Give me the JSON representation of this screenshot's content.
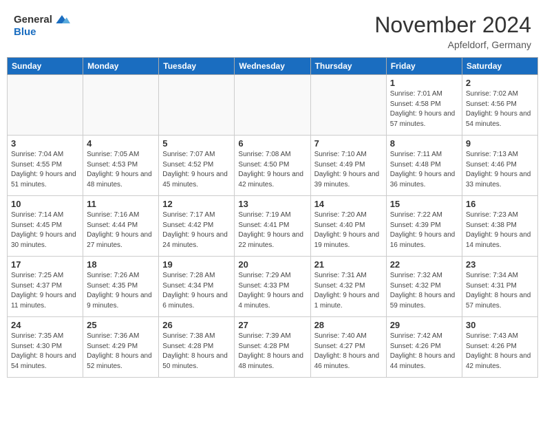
{
  "header": {
    "logo_general": "General",
    "logo_blue": "Blue",
    "title": "November 2024",
    "subtitle": "Apfeldorf, Germany"
  },
  "columns": [
    "Sunday",
    "Monday",
    "Tuesday",
    "Wednesday",
    "Thursday",
    "Friday",
    "Saturday"
  ],
  "weeks": [
    [
      {
        "day": "",
        "info": "",
        "empty": true
      },
      {
        "day": "",
        "info": "",
        "empty": true
      },
      {
        "day": "",
        "info": "",
        "empty": true
      },
      {
        "day": "",
        "info": "",
        "empty": true
      },
      {
        "day": "",
        "info": "",
        "empty": true
      },
      {
        "day": "1",
        "info": "Sunrise: 7:01 AM\nSunset: 4:58 PM\nDaylight: 9 hours and 57 minutes.",
        "empty": false
      },
      {
        "day": "2",
        "info": "Sunrise: 7:02 AM\nSunset: 4:56 PM\nDaylight: 9 hours and 54 minutes.",
        "empty": false
      }
    ],
    [
      {
        "day": "3",
        "info": "Sunrise: 7:04 AM\nSunset: 4:55 PM\nDaylight: 9 hours and 51 minutes.",
        "empty": false
      },
      {
        "day": "4",
        "info": "Sunrise: 7:05 AM\nSunset: 4:53 PM\nDaylight: 9 hours and 48 minutes.",
        "empty": false
      },
      {
        "day": "5",
        "info": "Sunrise: 7:07 AM\nSunset: 4:52 PM\nDaylight: 9 hours and 45 minutes.",
        "empty": false
      },
      {
        "day": "6",
        "info": "Sunrise: 7:08 AM\nSunset: 4:50 PM\nDaylight: 9 hours and 42 minutes.",
        "empty": false
      },
      {
        "day": "7",
        "info": "Sunrise: 7:10 AM\nSunset: 4:49 PM\nDaylight: 9 hours and 39 minutes.",
        "empty": false
      },
      {
        "day": "8",
        "info": "Sunrise: 7:11 AM\nSunset: 4:48 PM\nDaylight: 9 hours and 36 minutes.",
        "empty": false
      },
      {
        "day": "9",
        "info": "Sunrise: 7:13 AM\nSunset: 4:46 PM\nDaylight: 9 hours and 33 minutes.",
        "empty": false
      }
    ],
    [
      {
        "day": "10",
        "info": "Sunrise: 7:14 AM\nSunset: 4:45 PM\nDaylight: 9 hours and 30 minutes.",
        "empty": false
      },
      {
        "day": "11",
        "info": "Sunrise: 7:16 AM\nSunset: 4:44 PM\nDaylight: 9 hours and 27 minutes.",
        "empty": false
      },
      {
        "day": "12",
        "info": "Sunrise: 7:17 AM\nSunset: 4:42 PM\nDaylight: 9 hours and 24 minutes.",
        "empty": false
      },
      {
        "day": "13",
        "info": "Sunrise: 7:19 AM\nSunset: 4:41 PM\nDaylight: 9 hours and 22 minutes.",
        "empty": false
      },
      {
        "day": "14",
        "info": "Sunrise: 7:20 AM\nSunset: 4:40 PM\nDaylight: 9 hours and 19 minutes.",
        "empty": false
      },
      {
        "day": "15",
        "info": "Sunrise: 7:22 AM\nSunset: 4:39 PM\nDaylight: 9 hours and 16 minutes.",
        "empty": false
      },
      {
        "day": "16",
        "info": "Sunrise: 7:23 AM\nSunset: 4:38 PM\nDaylight: 9 hours and 14 minutes.",
        "empty": false
      }
    ],
    [
      {
        "day": "17",
        "info": "Sunrise: 7:25 AM\nSunset: 4:37 PM\nDaylight: 9 hours and 11 minutes.",
        "empty": false
      },
      {
        "day": "18",
        "info": "Sunrise: 7:26 AM\nSunset: 4:35 PM\nDaylight: 9 hours and 9 minutes.",
        "empty": false
      },
      {
        "day": "19",
        "info": "Sunrise: 7:28 AM\nSunset: 4:34 PM\nDaylight: 9 hours and 6 minutes.",
        "empty": false
      },
      {
        "day": "20",
        "info": "Sunrise: 7:29 AM\nSunset: 4:33 PM\nDaylight: 9 hours and 4 minutes.",
        "empty": false
      },
      {
        "day": "21",
        "info": "Sunrise: 7:31 AM\nSunset: 4:32 PM\nDaylight: 9 hours and 1 minute.",
        "empty": false
      },
      {
        "day": "22",
        "info": "Sunrise: 7:32 AM\nSunset: 4:32 PM\nDaylight: 8 hours and 59 minutes.",
        "empty": false
      },
      {
        "day": "23",
        "info": "Sunrise: 7:34 AM\nSunset: 4:31 PM\nDaylight: 8 hours and 57 minutes.",
        "empty": false
      }
    ],
    [
      {
        "day": "24",
        "info": "Sunrise: 7:35 AM\nSunset: 4:30 PM\nDaylight: 8 hours and 54 minutes.",
        "empty": false
      },
      {
        "day": "25",
        "info": "Sunrise: 7:36 AM\nSunset: 4:29 PM\nDaylight: 8 hours and 52 minutes.",
        "empty": false
      },
      {
        "day": "26",
        "info": "Sunrise: 7:38 AM\nSunset: 4:28 PM\nDaylight: 8 hours and 50 minutes.",
        "empty": false
      },
      {
        "day": "27",
        "info": "Sunrise: 7:39 AM\nSunset: 4:28 PM\nDaylight: 8 hours and 48 minutes.",
        "empty": false
      },
      {
        "day": "28",
        "info": "Sunrise: 7:40 AM\nSunset: 4:27 PM\nDaylight: 8 hours and 46 minutes.",
        "empty": false
      },
      {
        "day": "29",
        "info": "Sunrise: 7:42 AM\nSunset: 4:26 PM\nDaylight: 8 hours and 44 minutes.",
        "empty": false
      },
      {
        "day": "30",
        "info": "Sunrise: 7:43 AM\nSunset: 4:26 PM\nDaylight: 8 hours and 42 minutes.",
        "empty": false
      }
    ]
  ]
}
